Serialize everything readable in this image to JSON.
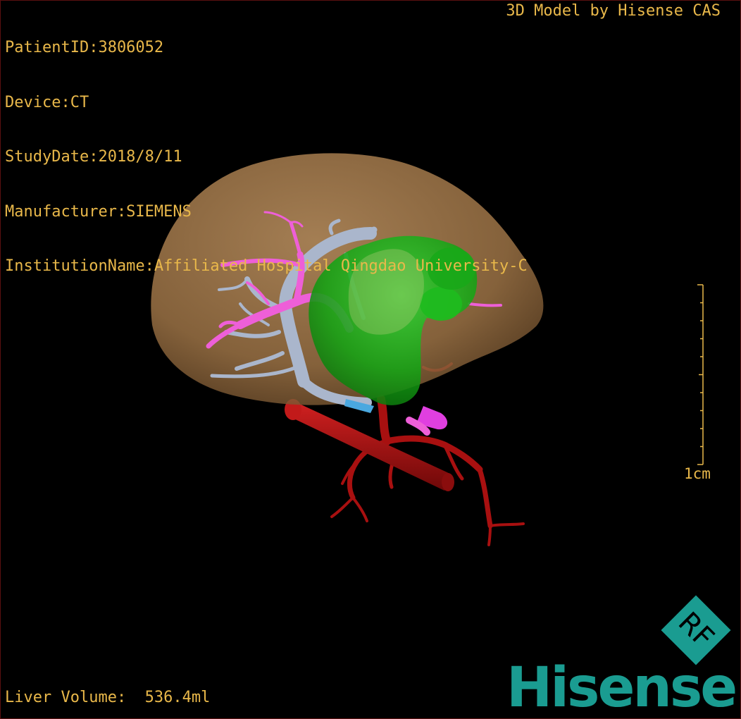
{
  "info": {
    "patient_id": "PatientID:3806052",
    "device": "Device:CT",
    "study_date": "StudyDate:2018/8/11",
    "manufacturer": "Manufacturer:SIEMENS",
    "institution": "InstitutionName:Affiliated Hospital Qingdao University-C"
  },
  "credit": "3D Model by Hisense CAS",
  "scale_label": "1cm",
  "volume_label": "Liver Volume:  536.4ml",
  "badge_text": "RF",
  "brand": "Hisense",
  "colors": {
    "overlay_text": "#e9b84a",
    "liver": "#b88a5a",
    "portal_vein": "#ee5fd8",
    "hepatic_vein": "#aeb8cc",
    "tumor": "#1aa81a",
    "artery": "#b01414",
    "brand": "#1a9c91"
  }
}
